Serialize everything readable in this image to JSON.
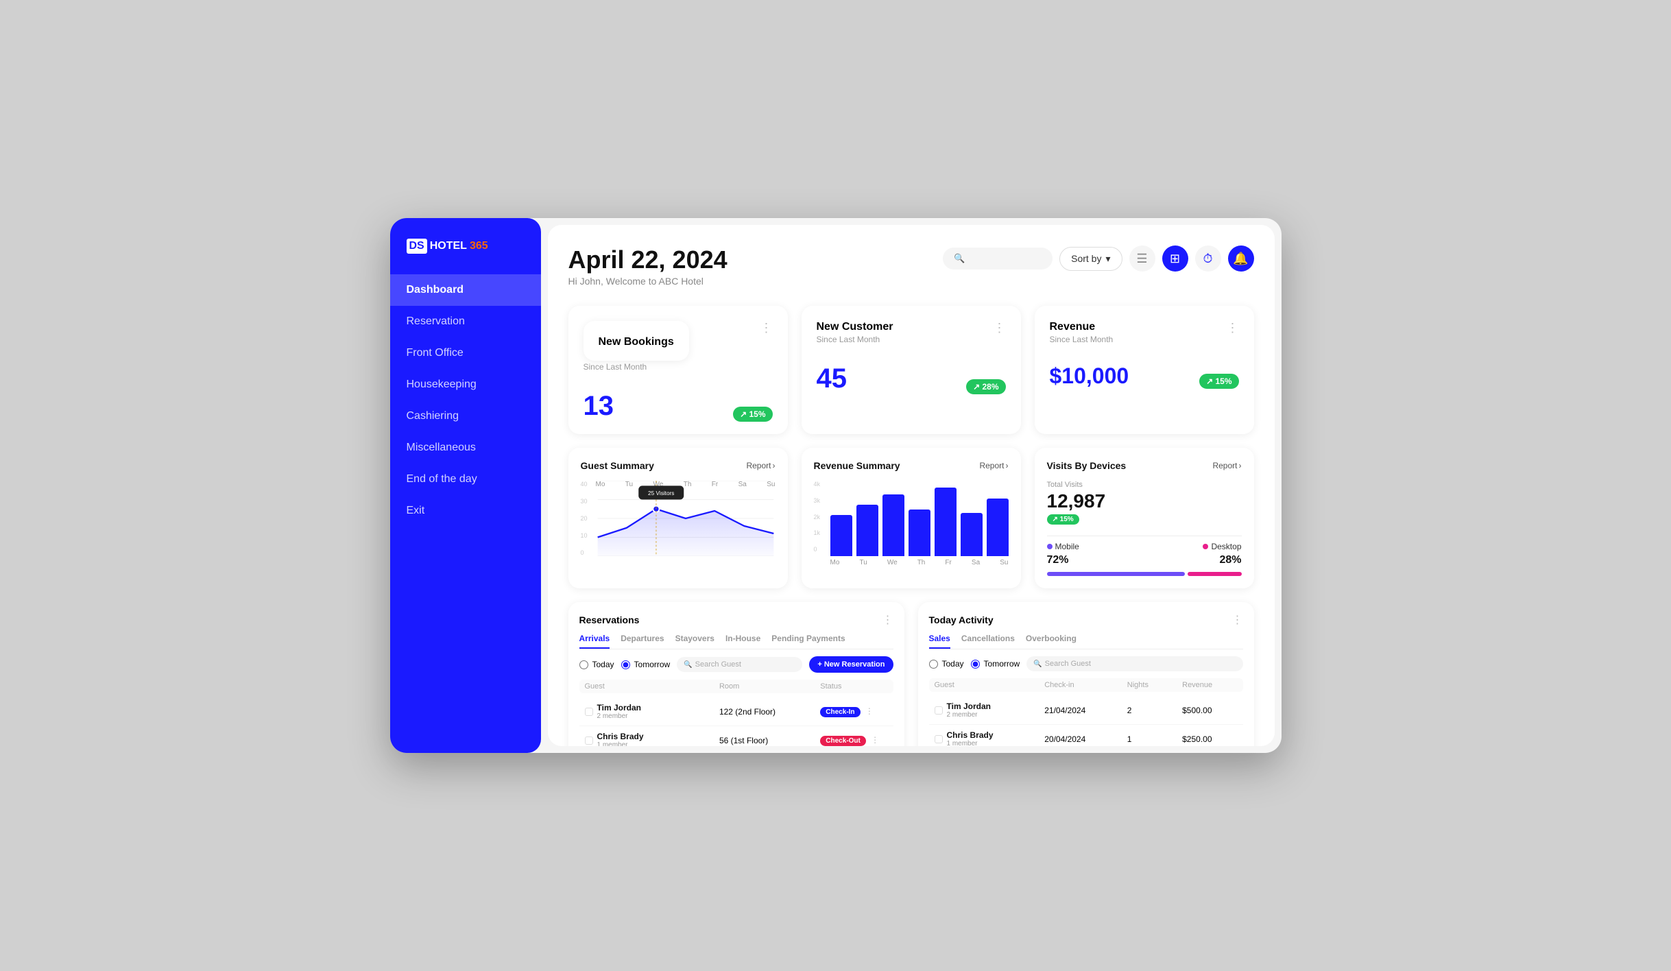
{
  "app": {
    "logo_ds": "DS",
    "logo_hotel": "HOTEL",
    "logo_365": "365"
  },
  "header": {
    "date": "April 22, 2024",
    "welcome": "Hi John, Welcome to ABC Hotel",
    "sort_label": "Sort by",
    "search_placeholder": "Search"
  },
  "nav": {
    "items": [
      {
        "label": "Dashboard",
        "active": true
      },
      {
        "label": "Reservation"
      },
      {
        "label": "Front Office"
      },
      {
        "label": "Housekeeping"
      },
      {
        "label": "Cashiering"
      },
      {
        "label": "Miscellaneous"
      },
      {
        "label": "End of the day"
      },
      {
        "label": "Exit"
      }
    ]
  },
  "stats": [
    {
      "title": "New Bookings",
      "subtitle": "Since Last Month",
      "value": "13",
      "badge": "↗ 15%"
    },
    {
      "title": "New Customer",
      "subtitle": "Since Last Month",
      "value": "45",
      "badge": "↗ 28%"
    },
    {
      "title": "Revenue",
      "subtitle": "Since Last Month",
      "value": "$10,000",
      "badge": "↗ 15%"
    }
  ],
  "guest_summary": {
    "title": "Guest Summary",
    "report": "Report",
    "tooltip": "25 Visitors",
    "x_labels": [
      "Mo",
      "Tu",
      "We",
      "Th",
      "Fr",
      "Sa",
      "Su"
    ],
    "y_labels": [
      "40",
      "30",
      "20",
      "10",
      "0"
    ],
    "values": [
      15,
      18,
      25,
      20,
      22,
      17,
      14
    ]
  },
  "revenue_summary": {
    "title": "Revenue Summary",
    "report": "Report",
    "x_labels": [
      "Mo",
      "Tu",
      "We",
      "Th",
      "Fr",
      "Sa",
      "Su"
    ],
    "y_labels": [
      "4k",
      "3k",
      "2k",
      "1k",
      "0"
    ],
    "values": [
      45,
      60,
      75,
      55,
      85,
      50,
      70
    ]
  },
  "visits_by_devices": {
    "title": "Visits By Devices",
    "report": "Report",
    "total_label": "Total Visits",
    "total_value": "12,987",
    "badge": "↗ 15%",
    "mobile_label": "Mobile",
    "desktop_label": "Desktop",
    "mobile_pct": "72%",
    "desktop_pct": "28%"
  },
  "reservations": {
    "title": "Reservations",
    "tabs": [
      "Arrivals",
      "Departures",
      "Stayovers",
      "In-House",
      "Pending Payments"
    ],
    "radio_today": "Today",
    "radio_tomorrow": "Tomorrow",
    "search_guest": "Search Guest",
    "new_reservation": "+ New Reservation",
    "columns": [
      "Guest",
      "Room",
      "Status"
    ],
    "rows": [
      {
        "name": "Tim Jordan",
        "member": "2 member",
        "room": "122 (2nd Floor)",
        "status": "Check-In",
        "status_type": "checkin"
      },
      {
        "name": "Chris Brady",
        "member": "1 member",
        "room": "56 (1st Floor)",
        "status": "Check-Out",
        "status_type": "checkout"
      }
    ]
  },
  "today_activity": {
    "title": "Today Activity",
    "tabs": [
      "Sales",
      "Cancellations",
      "Overbooking"
    ],
    "radio_today": "Today",
    "radio_tomorrow": "Tomorrow",
    "search_guest": "Search Guest",
    "columns": [
      "Guest",
      "Check-in",
      "Nights",
      "Revenue"
    ],
    "rows": [
      {
        "name": "Tim Jordan",
        "member": "2 member",
        "checkin": "21/04/2024",
        "nights": "2",
        "revenue": "$500.00"
      },
      {
        "name": "Chris Brady",
        "member": "1 member",
        "checkin": "20/04/2024",
        "nights": "1",
        "revenue": "$250.00"
      }
    ]
  }
}
